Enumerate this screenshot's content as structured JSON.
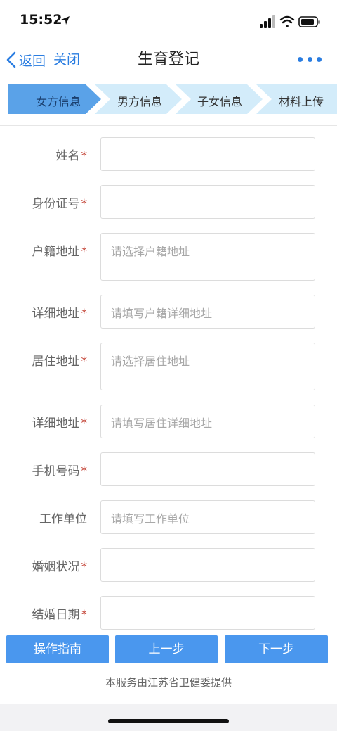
{
  "status": {
    "time": "15:52"
  },
  "nav": {
    "back_label": "返回",
    "close_label": "关闭",
    "title": "生育登记"
  },
  "steps": [
    {
      "label": "女方信息",
      "active": true
    },
    {
      "label": "男方信息",
      "active": false
    },
    {
      "label": "子女信息",
      "active": false
    },
    {
      "label": "材料上传",
      "active": false
    }
  ],
  "form": {
    "required_mark": "*",
    "fields": [
      {
        "label": "姓名",
        "placeholder": ""
      },
      {
        "label": "身份证号",
        "placeholder": ""
      },
      {
        "label": "户籍地址",
        "placeholder": "请选择户籍地址"
      },
      {
        "label": "详细地址",
        "placeholder": "请填写户籍详细地址"
      },
      {
        "label": "居住地址",
        "placeholder": "请选择居住地址"
      },
      {
        "label": "详细地址",
        "placeholder": "请填写居住详细地址"
      },
      {
        "label": "手机号码",
        "placeholder": ""
      },
      {
        "label": "工作单位",
        "placeholder": "请填写工作单位"
      },
      {
        "label": "婚姻状况",
        "placeholder": ""
      },
      {
        "label": "结婚日期",
        "placeholder": ""
      }
    ]
  },
  "buttons": {
    "guide": "操作指南",
    "prev": "上一步",
    "next": "下一步"
  },
  "footer": {
    "text": "本服务由江苏省卫健委提供"
  },
  "colors": {
    "accent": "#2a7de1",
    "button": "#4a97ee",
    "step_active": "#5aa2e8",
    "step_inactive": "#d3ecfa",
    "required": "#c0392b"
  }
}
